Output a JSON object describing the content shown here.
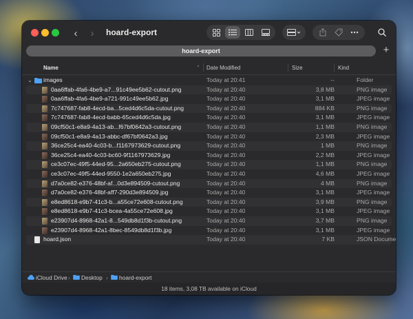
{
  "window": {
    "title": "hoard-export"
  },
  "tab": {
    "label": "hoard-export",
    "add_label": "+"
  },
  "columns": {
    "name": "Name",
    "date": "Date Modified",
    "size": "Size",
    "kind": "Kind"
  },
  "rows": [
    {
      "name": "images",
      "date": "Today at 20:41",
      "size": "--",
      "kind": "Folder",
      "type": "folder"
    },
    {
      "name": "0aa6ffab-4fa6-4be9-a7...91c49ee5b62-cutout.png",
      "date": "Today at 20:40",
      "size": "3,8 MB",
      "kind": "PNG image",
      "type": "image"
    },
    {
      "name": "0aa6ffab-4fa6-4be9-a721-991c49ee5b62.jpg",
      "date": "Today at 20:40",
      "size": "3,1 MB",
      "kind": "JPEG image",
      "type": "image"
    },
    {
      "name": "7c747687-fab8-4ecd-ba...5ced4d6c5da-cutout.png",
      "date": "Today at 20:40",
      "size": "884 KB",
      "kind": "PNG image",
      "type": "image"
    },
    {
      "name": "7c747687-fab8-4ecd-babb-65ced4d6c5da.jpg",
      "date": "Today at 20:40",
      "size": "3,1 MB",
      "kind": "JPEG image",
      "type": "image"
    },
    {
      "name": "09cf50c1-e8a9-4a13-ab...f67bf0642a3-cutout.png",
      "date": "Today at 20:40",
      "size": "1,1 MB",
      "kind": "PNG image",
      "type": "image"
    },
    {
      "name": "09cf50c1-e8a9-4a13-abbc-df67bf0642a3.jpg",
      "date": "Today at 20:40",
      "size": "2,3 MB",
      "kind": "JPEG image",
      "type": "image"
    },
    {
      "name": "36ce25c4-ea40-4c03-b...f1167973629-cutout.png",
      "date": "Today at 20:40",
      "size": "1 MB",
      "kind": "PNG image",
      "type": "image"
    },
    {
      "name": "36ce25c4-ea40-4c03-bc60-9f1167973629.jpg",
      "date": "Today at 20:40",
      "size": "2,2 MB",
      "kind": "JPEG image",
      "type": "image"
    },
    {
      "name": "ce3c07ec-49f5-44ed-95...2a650eb275-cutout.png",
      "date": "Today at 20:40",
      "size": "1,1 MB",
      "kind": "PNG image",
      "type": "image"
    },
    {
      "name": "ce3c07ec-49f5-44ed-9550-1e2a650eb275.jpg",
      "date": "Today at 20:40",
      "size": "4,6 MB",
      "kind": "JPEG image",
      "type": "image"
    },
    {
      "name": "d7a0ce82-e376-48bf-af...0d3e894509-cutout.png",
      "date": "Today at 20:40",
      "size": "4 MB",
      "kind": "PNG image",
      "type": "image"
    },
    {
      "name": "d7a0ce82-e376-48bf-aff7-290d3e894509.jpg",
      "date": "Today at 20:40",
      "size": "3,1 MB",
      "kind": "JPEG image",
      "type": "image"
    },
    {
      "name": "e8ed8618-e9b7-41c3-b...a55ce72e608-cutout.png",
      "date": "Today at 20:40",
      "size": "3,9 MB",
      "kind": "PNG image",
      "type": "image"
    },
    {
      "name": "e8ed8618-e9b7-41c3-bcea-4a55ce72e608.jpg",
      "date": "Today at 20:40",
      "size": "3,1 MB",
      "kind": "JPEG image",
      "type": "image"
    },
    {
      "name": "e23907d4-8968-42a1-8...549db8d1f3b-cutout.png",
      "date": "Today at 20:40",
      "size": "3,7 MB",
      "kind": "PNG image",
      "type": "image"
    },
    {
      "name": "e23907d4-8968-42a1-8bec-8549db8d1f3b.jpg",
      "date": "Today at 20:40",
      "size": "3,1 MB",
      "kind": "JPEG image",
      "type": "image"
    },
    {
      "name": "hoard.json",
      "date": "Today at 20:40",
      "size": "7 KB",
      "kind": "JSON Document",
      "type": "json"
    }
  ],
  "path": {
    "items": [
      "iCloud Drive",
      "Desktop",
      "hoard-export"
    ]
  },
  "status": {
    "text": "18 items, 3,08 TB available on iCloud"
  },
  "icons": {
    "back": "chevron-left-icon",
    "forward": "chevron-right-icon",
    "icon_view": "grid-icon",
    "list_view": "list-icon",
    "column_view": "columns-icon",
    "gallery_view": "gallery-icon",
    "group": "group-icon",
    "share": "share-icon",
    "tag": "tag-icon",
    "more": "more-icon",
    "search": "search-icon"
  },
  "colors": {
    "window_bg": "#2a2a2c",
    "folder": "#4ea1f3",
    "close": "#fe5f57",
    "minimize": "#febc2e",
    "zoom": "#28c840"
  }
}
